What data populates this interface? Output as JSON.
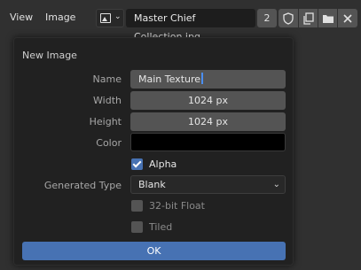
{
  "header": {
    "menus": [
      "View",
      "Image"
    ],
    "image_name": "Master Chief Collection.jpg",
    "users_count": "2",
    "icons": {
      "image_type": "image-icon",
      "fake_user": "shield-icon",
      "duplicate": "duplicate-icon",
      "open": "folder-icon",
      "close": "close-icon"
    }
  },
  "dialog": {
    "title": "New Image",
    "name_label": "Name",
    "name_value": "Main Texture",
    "width_label": "Width",
    "width_value": "1024 px",
    "height_label": "Height",
    "height_value": "1024 px",
    "color_label": "Color",
    "color_value": "#000000",
    "alpha_label": "Alpha",
    "alpha_checked": true,
    "generated_type_label": "Generated Type",
    "generated_type_value": "Blank",
    "float_label": "32-bit Float",
    "float_checked": false,
    "tiled_label": "Tiled",
    "tiled_checked": false,
    "ok_label": "OK"
  },
  "colors": {
    "accent": "#4772b3",
    "background": "#303030",
    "dialog": "#212121"
  }
}
